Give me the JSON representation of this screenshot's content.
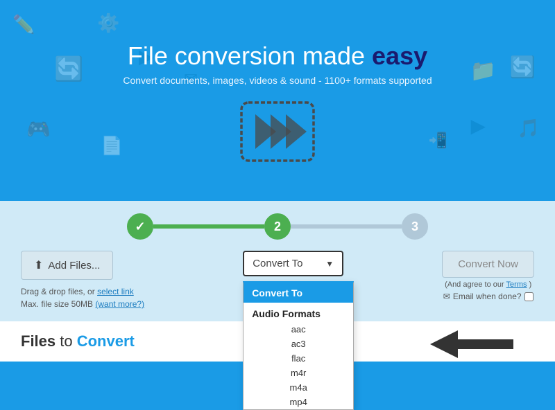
{
  "hero": {
    "title_start": "File ",
    "title_conversion": "conversion",
    "title_middle": " made ",
    "title_easy": "easy",
    "subtitle": "Convert documents, images, videos & sound - 1100+ formats supported"
  },
  "steps": [
    {
      "id": 1,
      "label": "✓",
      "state": "done"
    },
    {
      "id": 2,
      "label": "2",
      "state": "active"
    },
    {
      "id": 3,
      "label": "3",
      "state": "inactive"
    }
  ],
  "controls": {
    "add_files_label": "Add Files...",
    "drag_text_line1": "Drag & drop files, or",
    "drag_text_link": "select link",
    "drag_text_line2": "Max. file size 50MB",
    "drag_text_link2": "(want more?)",
    "convert_to_label": "Convert To",
    "convert_now_label": "Convert Now",
    "terms_text": "(And agree to our",
    "terms_link": "Terms",
    "terms_close": ")",
    "email_label": "Email when done?"
  },
  "dropdown": {
    "header": "Convert To",
    "category": "Audio Formats",
    "items": [
      "aac",
      "ac3",
      "flac",
      "m4r",
      "m4a",
      "mp4"
    ]
  },
  "bottom": {
    "files_label_prefix": "Files",
    "files_label_to": " to ",
    "files_label_convert": "Convert"
  }
}
